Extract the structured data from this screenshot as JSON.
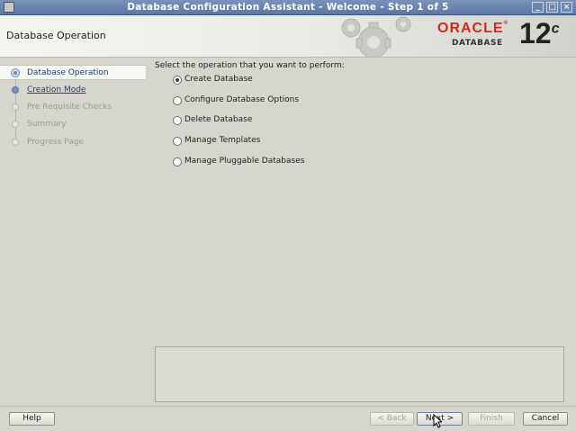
{
  "window": {
    "title": "Database Configuration Assistant - Welcome - Step 1 of 5",
    "controls": [
      "_",
      "□",
      "×"
    ]
  },
  "header": {
    "page_title": "Database Operation",
    "brand": "ORACLE",
    "brand_reg": "®",
    "brand_sub": "DATABASE",
    "version": "12",
    "version_suffix": "c"
  },
  "sidebar": {
    "steps": [
      {
        "label": "Database Operation",
        "state": "current"
      },
      {
        "label": "Creation Mode",
        "state": "link"
      },
      {
        "label": "Pre Requisite Checks",
        "state": "disabled"
      },
      {
        "label": "Summary",
        "state": "disabled"
      },
      {
        "label": "Progress Page",
        "state": "disabled"
      }
    ]
  },
  "content": {
    "prompt": "Select the operation that you want to perform:",
    "options": [
      {
        "label": "Create Database",
        "selected": true
      },
      {
        "label": "Configure Database Options",
        "selected": false
      },
      {
        "label": "Delete Database",
        "selected": false
      },
      {
        "label": "Manage Templates",
        "selected": false
      },
      {
        "label": "Manage Pluggable Databases",
        "selected": false
      }
    ]
  },
  "footer": {
    "help": "Help",
    "back": "< Back",
    "next": "Next >",
    "finish": "Finish",
    "cancel": "Cancel"
  }
}
